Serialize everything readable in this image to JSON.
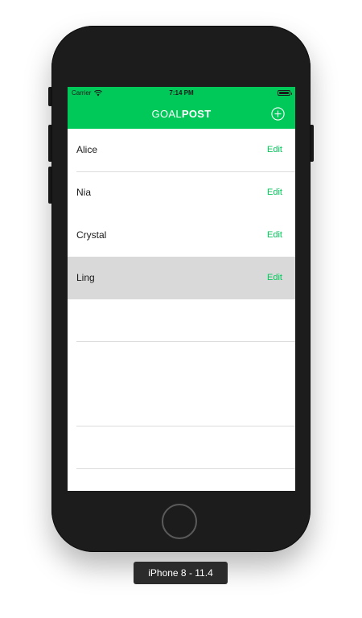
{
  "status_bar": {
    "carrier": "Carrier",
    "time": "7:14 PM"
  },
  "nav": {
    "title_light": "GOAL",
    "title_bold": "POST",
    "add_icon": "plus-circle-icon"
  },
  "rows": [
    {
      "name": "Alice",
      "edit_label": "Edit",
      "selected": false
    },
    {
      "name": "Nia",
      "edit_label": "Edit",
      "selected": false
    },
    {
      "name": "Crystal",
      "edit_label": "Edit",
      "selected": false
    },
    {
      "name": "Ling",
      "edit_label": "Edit",
      "selected": true
    }
  ],
  "device_label": "iPhone 8 - 11.4",
  "colors": {
    "accent": "#00c95a",
    "selected_row": "#d9d9d9",
    "device_body": "#1c1c1c"
  }
}
